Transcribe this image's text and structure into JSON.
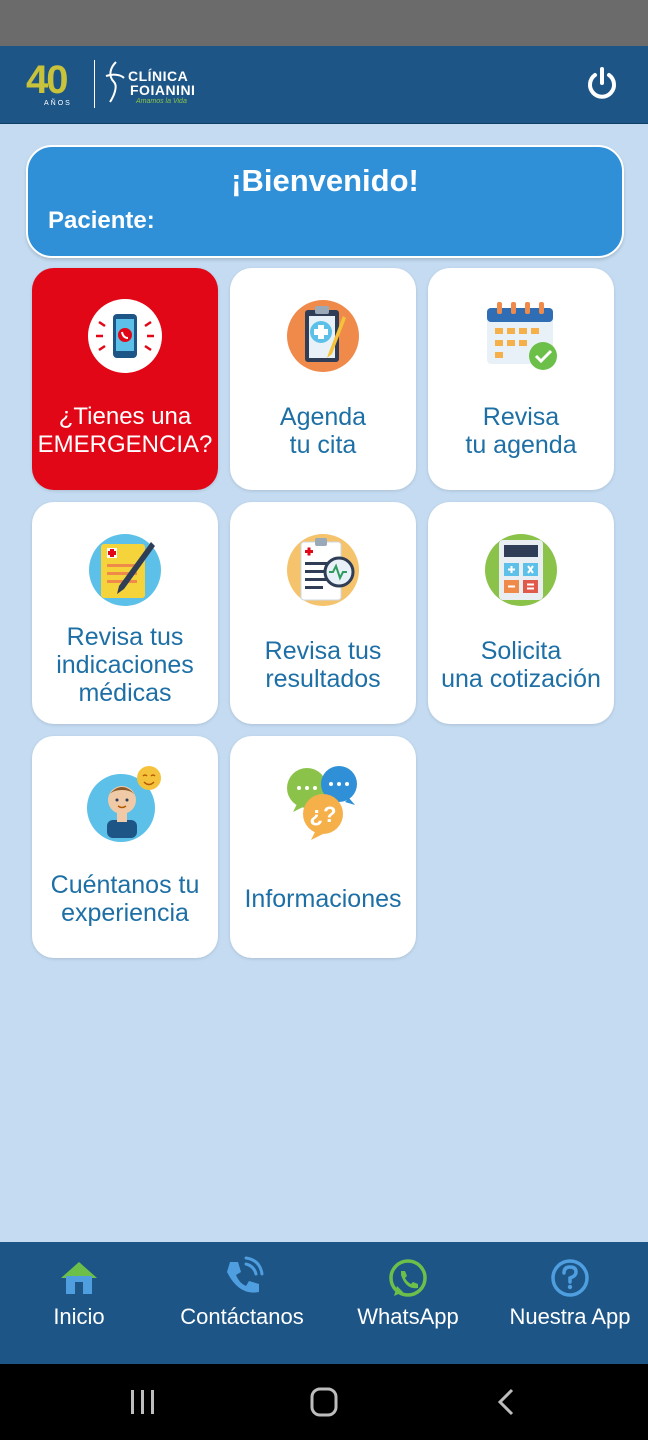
{
  "header": {
    "logo": {
      "years_number": "40",
      "years_label": "AÑOS",
      "brand_line1": "CLÍNICA",
      "brand_line2": "FOIANINI",
      "tagline": "Amamos la Vida"
    },
    "power_icon": "power-icon"
  },
  "welcome": {
    "title": "¡Bienvenido!",
    "patient_label": "Paciente:"
  },
  "tiles": [
    {
      "lines": [
        "¿Tienes una",
        "EMERGENCIA?"
      ],
      "icon": "emergency-phone-icon"
    },
    {
      "lines": [
        "Agenda",
        "tu cita"
      ],
      "icon": "clipboard-icon"
    },
    {
      "lines": [
        "Revisa",
        "tu agenda"
      ],
      "icon": "calendar-icon"
    },
    {
      "lines": [
        "Revisa tus",
        "indicaciones",
        "médicas"
      ],
      "icon": "prescription-icon"
    },
    {
      "lines": [
        "Revisa tus",
        "resultados"
      ],
      "icon": "lab-results-icon"
    },
    {
      "lines": [
        "Solicita",
        "una cotización"
      ],
      "icon": "calculator-icon"
    },
    {
      "lines": [
        "Cuéntanos tu",
        "experiencia"
      ],
      "icon": "feedback-person-icon"
    },
    {
      "lines": [
        "Informaciones"
      ],
      "icon": "chat-bubbles-icon"
    }
  ],
  "bottom_nav": [
    {
      "label": "Inicio",
      "icon": "home-icon"
    },
    {
      "label": "Contáctanos",
      "icon": "phone-icon"
    },
    {
      "label": "WhatsApp",
      "icon": "whatsapp-icon"
    },
    {
      "label": "Nuestra App",
      "icon": "help-icon"
    }
  ],
  "colors": {
    "primary": "#1d5587",
    "background": "#c4dbf1",
    "welcome_card": "#2f8fd7",
    "emergency": "#e10717",
    "tile_text": "#1d6fa5"
  }
}
